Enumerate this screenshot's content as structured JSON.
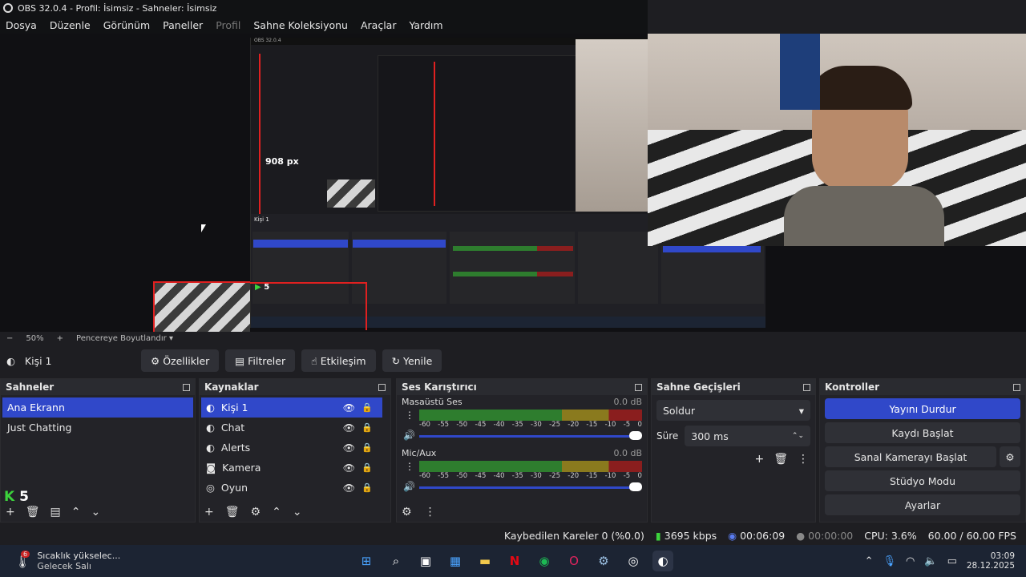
{
  "window": {
    "title": "OBS 32.0.4 - Profil: İsimsiz - Sahneler: İsimsiz"
  },
  "menu": [
    "Dosya",
    "Düzenle",
    "Görünüm",
    "Paneller",
    "Profil",
    "Sahne Koleksiyonu",
    "Araçlar",
    "Yardım"
  ],
  "preview": {
    "label_px": "908 px",
    "nested_label": "5",
    "source_name_small": "Kişi 1"
  },
  "zoom": {
    "minus": "−",
    "value": "50%",
    "plus": "+",
    "fit": "Pencereye Boyutlandır"
  },
  "source_bar": {
    "name": "Kişi 1",
    "properties": "Özellikler",
    "filters": "Filtreler",
    "interact": "Etkileşim",
    "refresh": "Yenile"
  },
  "scenes": {
    "title": "Sahneler",
    "items": [
      "Ana Ekrann",
      "Just Chatting"
    ],
    "badge": "5"
  },
  "sources": {
    "title": "Kaynaklar",
    "items": [
      "Kişi 1",
      "Chat",
      "Alerts",
      "Kamera",
      "Oyun"
    ]
  },
  "mixer": {
    "title": "Ses Karıştırıcı",
    "channels": [
      {
        "name": "Masaüstü Ses",
        "db": "0.0 dB"
      },
      {
        "name": "Mic/Aux",
        "db": "0.0 dB"
      }
    ],
    "ticks": [
      "-60",
      "-55",
      "-50",
      "-45",
      "-40",
      "-35",
      "-30",
      "-25",
      "-20",
      "-15",
      "-10",
      "-5",
      "0"
    ]
  },
  "transitions": {
    "title": "Sahne Geçişleri",
    "selected": "Soldur",
    "duration_label": "Süre",
    "duration_value": "300 ms"
  },
  "controls": {
    "title": "Kontroller",
    "stream": "Yayını Durdur",
    "record": "Kaydı Başlat",
    "virtualcam": "Sanal Kamerayı Başlat",
    "studio": "Stüdyo Modu",
    "settings": "Ayarlar"
  },
  "status": {
    "dropped": "Kaybedilen Kareler 0 (%0.0)",
    "bitrate": "3695 kbps",
    "stream_time": "00:06:09",
    "rec_time": "00:00:00",
    "cpu": "CPU: 3.6%",
    "fps": "60.00 / 60.00 FPS"
  },
  "taskbar": {
    "weather_title": "Sıcaklık yükselec...",
    "weather_sub": "Gelecek Salı",
    "weather_badge": "6",
    "time": "03:09",
    "date": "28.12.2025"
  },
  "colors": {
    "accent": "#3048c9",
    "live": "#2e7d2e",
    "red": "#e02020"
  }
}
